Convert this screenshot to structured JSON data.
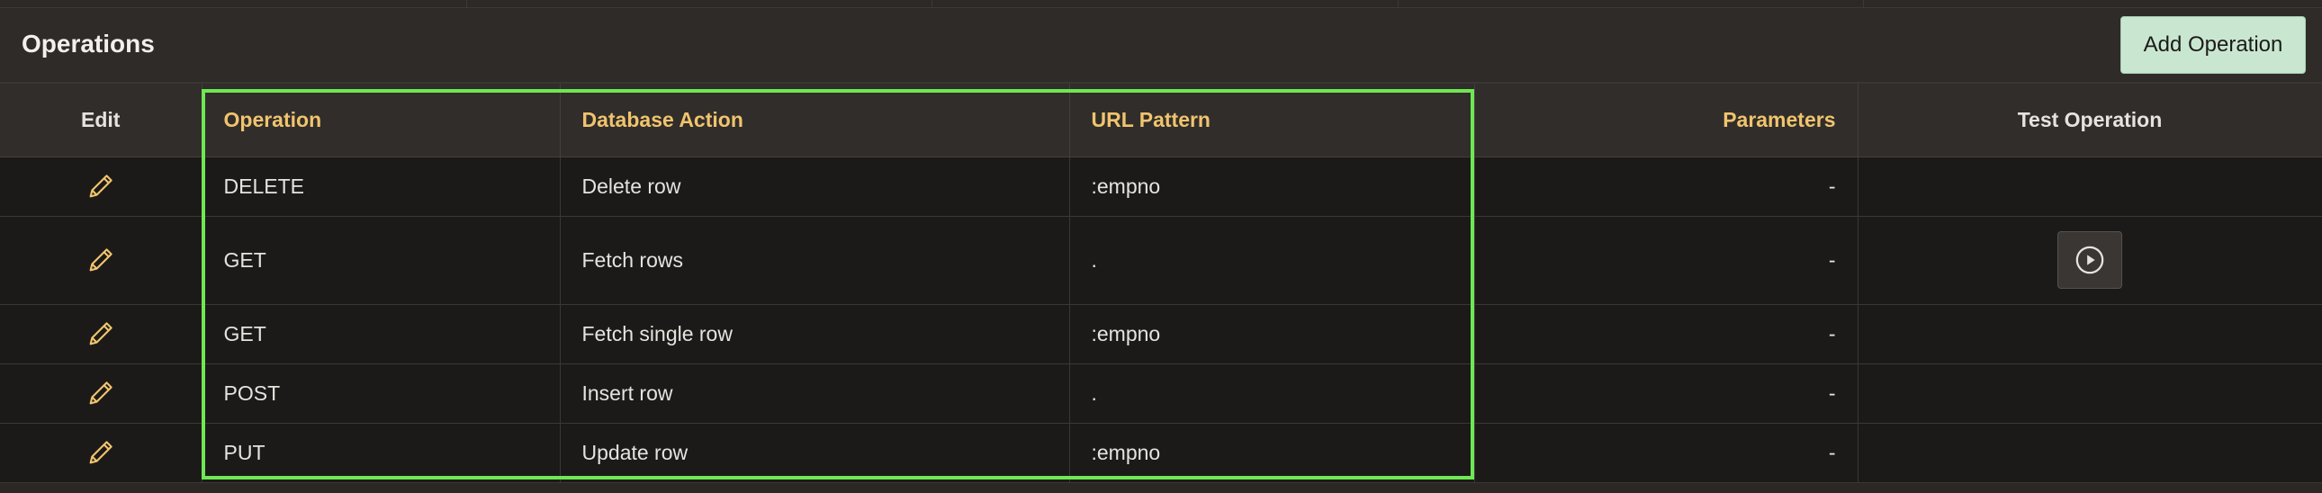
{
  "region": {
    "title": "Operations",
    "add_button_label": "Add Operation"
  },
  "columns": {
    "edit": "Edit",
    "operation": "Operation",
    "database_action": "Database Action",
    "url_pattern": "URL Pattern",
    "parameters": "Parameters",
    "test_operation": "Test Operation"
  },
  "rows": [
    {
      "operation": "DELETE",
      "database_action": "Delete row",
      "url_pattern": ":empno",
      "parameters": "-",
      "has_test": false
    },
    {
      "operation": "GET",
      "database_action": "Fetch rows",
      "url_pattern": ".",
      "parameters": "-",
      "has_test": true
    },
    {
      "operation": "GET",
      "database_action": "Fetch single row",
      "url_pattern": ":empno",
      "parameters": "-",
      "has_test": false
    },
    {
      "operation": "POST",
      "database_action": "Insert row",
      "url_pattern": ".",
      "parameters": "-",
      "has_test": false
    },
    {
      "operation": "PUT",
      "database_action": "Update row",
      "url_pattern": ":empno",
      "parameters": "-",
      "has_test": false
    }
  ],
  "icons": {
    "edit": "pencil-icon",
    "test": "play-icon"
  },
  "colors": {
    "accent_header": "#f0c46e",
    "highlight_box": "#6ee853",
    "add_button_bg": "#c9e7d0"
  }
}
